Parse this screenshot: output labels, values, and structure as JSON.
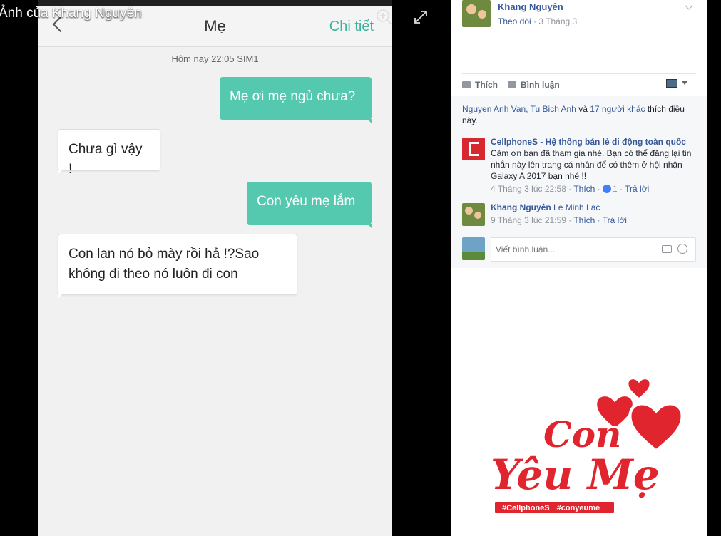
{
  "viewer": {
    "title": "Ảnh của Khang Nguyên",
    "zoom_icon": "zoom-in-icon",
    "expand_icon": "expand-icon"
  },
  "photo": {
    "contact_name": "Mẹ",
    "detail_label": "Chi tiết",
    "thread_meta": "Hôm nay  22:05  SIM1",
    "messages": [
      {
        "direction": "out",
        "text": "Mẹ ơi mẹ ngủ chưa?"
      },
      {
        "direction": "in",
        "text": "Chưa gì vậy !"
      },
      {
        "direction": "out",
        "text": "Con yêu mẹ lắm"
      },
      {
        "direction": "in",
        "text": "Con lan nó bỏ mày rồi hả !?Sao không đi theo nó luôn đi con"
      }
    ]
  },
  "post": {
    "author": "Khang Nguyên",
    "follow_label": "Theo dõi",
    "date": "3 Tháng 3",
    "like_label": "Thích",
    "comment_label": "Bình luận",
    "likes_people": "Nguyen Anh Van, Tu Bich Anh",
    "likes_and": " và ",
    "likes_others": "17 người khác",
    "likes_suffix": " thích điều này."
  },
  "comments": [
    {
      "author": "CellphoneS - Hệ thống bán lẻ di động toàn quốc",
      "text": "Cảm ơn bạn đã tham gia nhé. Bạn có thể đăng lại tin nhắn này lên trang cá nhân để có thêm ở hội nhận Galaxy A 2017 bạn nhé !!",
      "time": "4 Tháng 3 lúc 22:58",
      "like": "Thích",
      "reactions": "1",
      "reply": "Trả lời"
    },
    {
      "author": "Khang Nguyên",
      "text": "Le Minh Lac",
      "time": "9 Tháng 3 lúc 21:59",
      "like": "Thích",
      "reply": "Trả lời"
    }
  ],
  "composer": {
    "placeholder": "Viết bình luận..."
  },
  "sticker": {
    "word1": "Con",
    "word2": "Yêu Mẹ",
    "tag1": "#CellphoneS",
    "tag2": "#conyeume"
  },
  "colors": {
    "out_bubble": "#55c8b0",
    "accent_link": "#365899",
    "brand_red": "#e1252f"
  }
}
